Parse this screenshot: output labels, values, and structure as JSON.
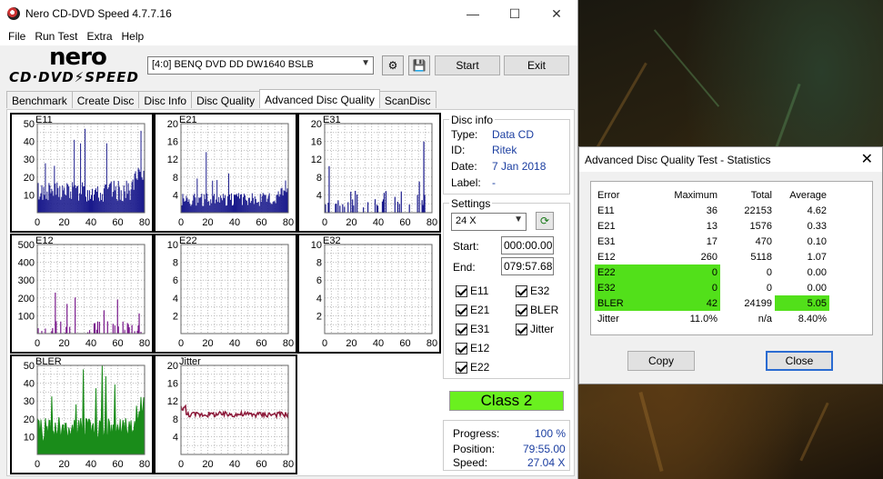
{
  "window": {
    "title": "Nero CD-DVD Speed 4.7.7.16",
    "minimize": "—",
    "maximize": "☐",
    "close": "✕"
  },
  "menu": [
    "File",
    "Run Test",
    "Extra",
    "Help"
  ],
  "logo": {
    "line1": "nero",
    "line2": "CD·DVD⚡SPEED"
  },
  "toolbar": {
    "drive": "[4:0]   BENQ DVD DD DW1640 BSLB",
    "start_label": "Start",
    "exit_label": "Exit"
  },
  "tabs": [
    "Benchmark",
    "Create Disc",
    "Disc Info",
    "Disc Quality",
    "Advanced Disc Quality",
    "ScanDisc"
  ],
  "active_tab": 4,
  "disc_info": {
    "header": "Disc info",
    "type_label": "Type:",
    "type": "Data CD",
    "id_label": "ID:",
    "id": "Ritek",
    "date_label": "Date:",
    "date": "7 Jan 2018",
    "label_label": "Label:",
    "label": "-"
  },
  "settings": {
    "header": "Settings",
    "speed": "24 X",
    "start_label": "Start:",
    "start": "000:00.00",
    "end_label": "End:",
    "end": "079:57.68",
    "checks": [
      "E11",
      "E32",
      "E21",
      "BLER",
      "E31",
      "Jitter",
      "E12",
      "E22"
    ]
  },
  "result": {
    "class_label": "Class 2"
  },
  "progress": {
    "progress_label": "Progress:",
    "progress": "100 %",
    "position_label": "Position:",
    "position": "79:55.00",
    "speed_label": "Speed:",
    "speed": "27.04 X"
  },
  "graphs": [
    {
      "name": "E11",
      "ymax": 50,
      "yticks": [
        10,
        20,
        30,
        40,
        50
      ],
      "color": "#1a1a8c",
      "type": "bars",
      "base": 12,
      "spike": 40
    },
    {
      "name": "E21",
      "ymax": 20,
      "yticks": [
        4,
        8,
        12,
        16,
        20
      ],
      "color": "#1a1a8c",
      "type": "bars",
      "base": 3,
      "spike": 12
    },
    {
      "name": "E31",
      "ymax": 20,
      "yticks": [
        4,
        8,
        12,
        16,
        20
      ],
      "color": "#1a1a8c",
      "type": "sparse",
      "base": 1,
      "spike": 16
    },
    {
      "name": "E12",
      "ymax": 500,
      "yticks": [
        100,
        200,
        300,
        400,
        500
      ],
      "color": "#7a1a8c",
      "type": "sparse",
      "base": 5,
      "spike": 260
    },
    {
      "name": "E22",
      "ymax": 10,
      "yticks": [
        2,
        4,
        6,
        8,
        10
      ],
      "color": "#1a1a8c",
      "type": "empty"
    },
    {
      "name": "E32",
      "ymax": 10,
      "yticks": [
        2,
        4,
        6,
        8,
        10
      ],
      "color": "#1a1a8c",
      "type": "empty"
    },
    {
      "name": "BLER",
      "ymax": 50,
      "yticks": [
        10,
        20,
        30,
        40,
        50
      ],
      "color": "#1a8c1a",
      "type": "fill",
      "base": 14,
      "spike": 42
    },
    {
      "name": "Jitter",
      "ymax": 20,
      "yticks": [
        4,
        8,
        12,
        16,
        20
      ],
      "color": "#8c1a3a",
      "type": "line",
      "base": 9
    }
  ],
  "xticks": [
    0,
    20,
    40,
    60,
    80
  ],
  "stats": {
    "title": "Advanced Disc Quality Test - Statistics",
    "headers": [
      "Error",
      "Maximum",
      "Total",
      "Average"
    ],
    "rows": [
      [
        "E11",
        "36",
        "22153",
        "4.62"
      ],
      [
        "E21",
        "13",
        "1576",
        "0.33"
      ],
      [
        "E31",
        "17",
        "470",
        "0.10"
      ],
      [
        "E12",
        "260",
        "5118",
        "1.07"
      ],
      [
        "E22",
        "0",
        "0",
        "0.00"
      ],
      [
        "E32",
        "0",
        "0",
        "0.00"
      ],
      [
        "BLER",
        "42",
        "24199",
        "5.05"
      ],
      [
        "Jitter",
        "11.0%",
        "n/a",
        "8.40%"
      ]
    ],
    "highlight_color": "#52e01a",
    "copy_label": "Copy",
    "close_label": "Close"
  }
}
